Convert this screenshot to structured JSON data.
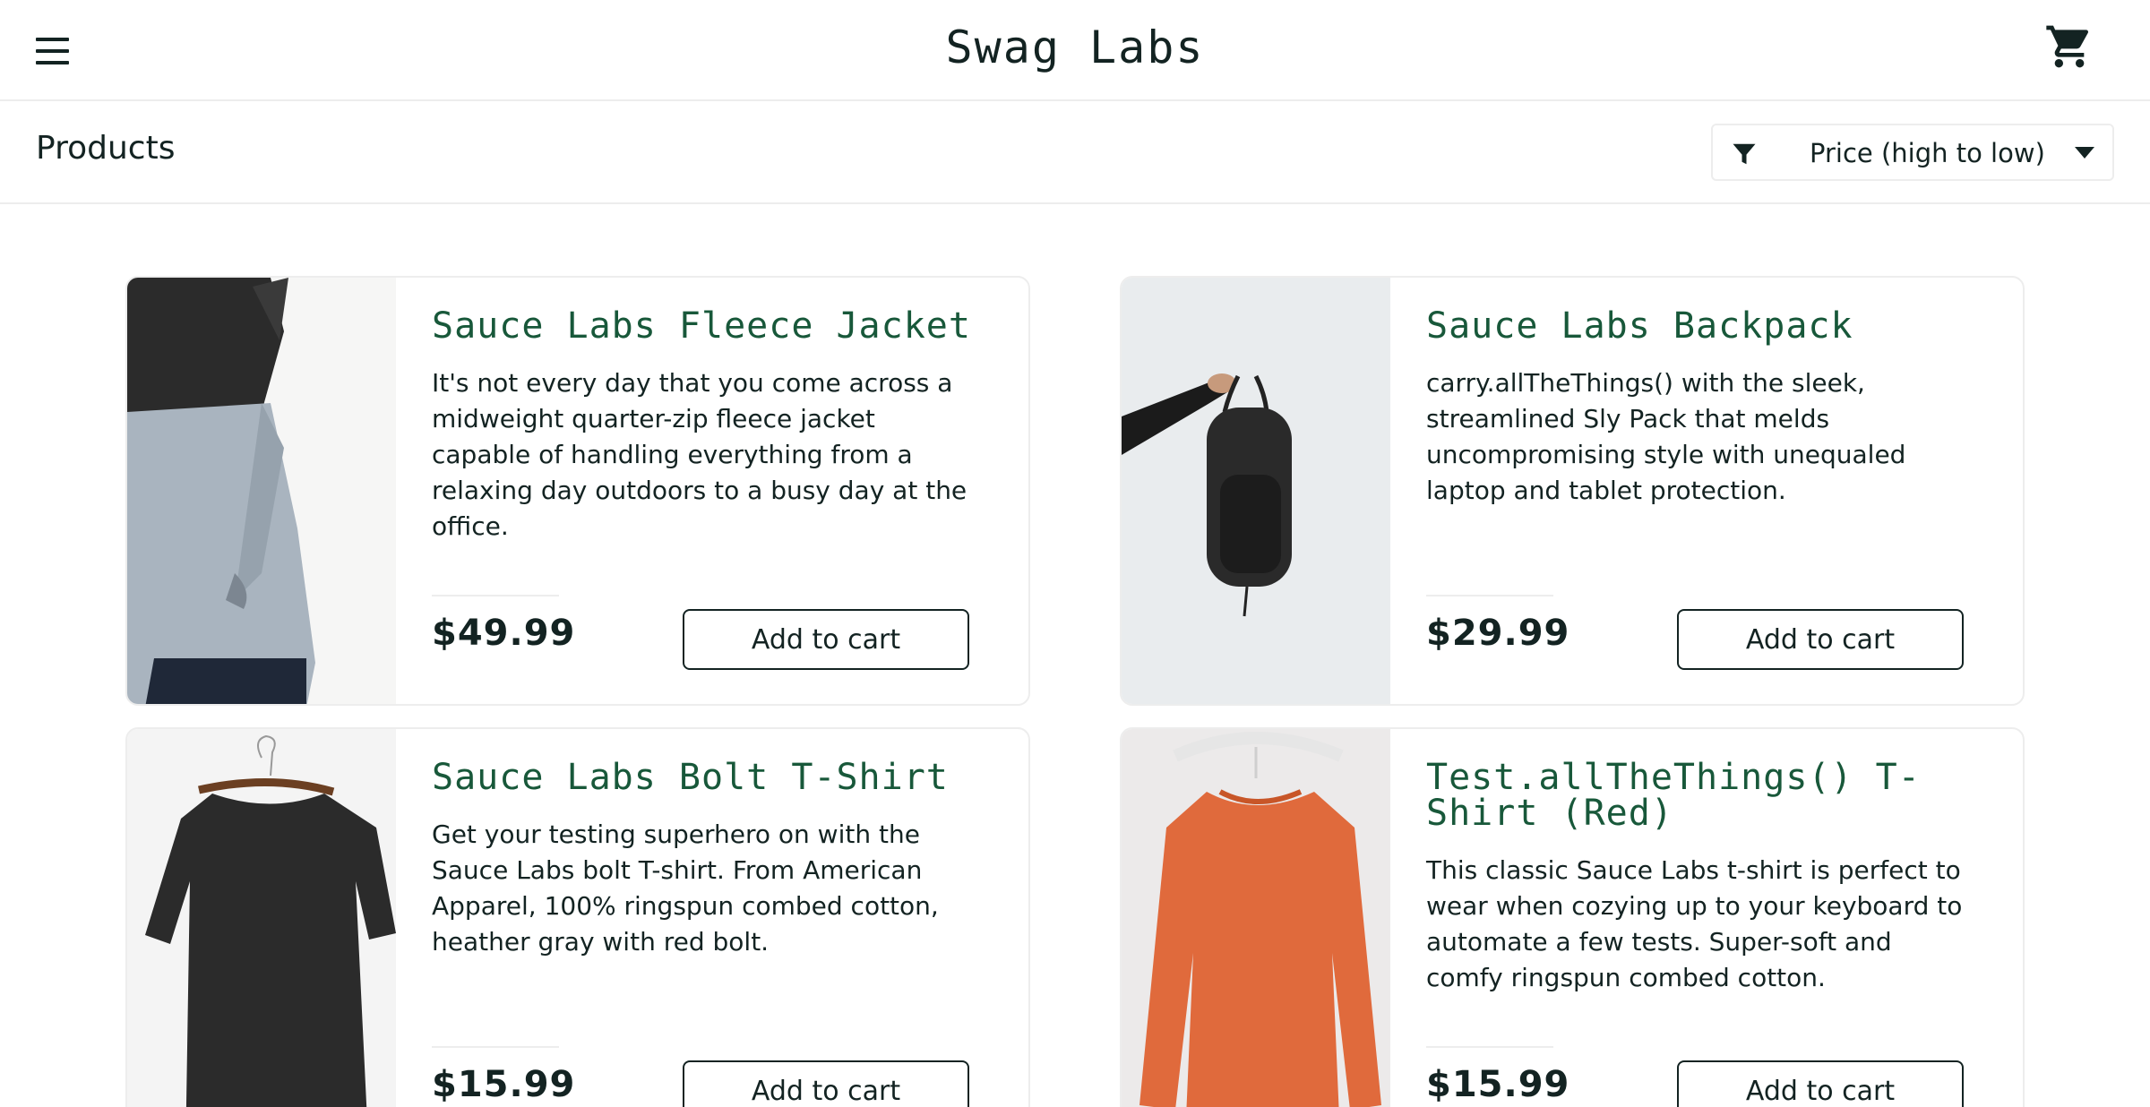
{
  "app": {
    "title": "Swag Labs"
  },
  "header": {
    "menu_icon": "hamburger-menu-icon",
    "cart_icon": "shopping-cart-icon"
  },
  "subheader": {
    "title": "Products",
    "sort": {
      "icon": "filter-icon",
      "selected": "Price (high to low)",
      "caret_icon": "caret-down-icon"
    }
  },
  "colors": {
    "accent": "#18583a",
    "text": "#132322",
    "border": "#ededed",
    "background": "#ffffff"
  },
  "products": [
    {
      "name": "Sauce Labs Fleece Jacket",
      "description": "It's not every day that you come across a midweight quarter-zip fleece jacket capable of handling everything from a relaxing day outdoors to a busy day at the office.",
      "price": "$49.99",
      "button": "Add to cart",
      "image": "fleece-jacket-image"
    },
    {
      "name": "Sauce Labs Backpack",
      "description": "carry.allTheThings() with the sleek, streamlined Sly Pack that melds uncompromising style with unequaled laptop and tablet protection.",
      "price": "$29.99",
      "button": "Add to cart",
      "image": "backpack-image"
    },
    {
      "name": "Sauce Labs Bolt T-Shirt",
      "description": "Get your testing superhero on with the Sauce Labs bolt T-shirt. From American Apparel, 100% ringspun combed cotton, heather gray with red bolt.",
      "price": "$15.99",
      "button": "Add to cart",
      "image": "bolt-tshirt-image"
    },
    {
      "name": "Test.allTheThings() T-Shirt (Red)",
      "description": "This classic Sauce Labs t-shirt is perfect to wear when cozying up to your keyboard to automate a few tests. Super-soft and comfy ringspun combed cotton.",
      "price": "$15.99",
      "button": "Add to cart",
      "image": "red-tshirt-image"
    }
  ]
}
